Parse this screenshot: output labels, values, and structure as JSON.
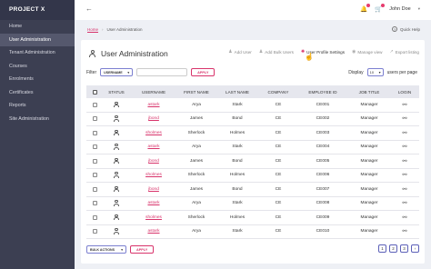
{
  "brand": "PROJECT X",
  "sidebar": {
    "items": [
      {
        "label": "Home",
        "active": false
      },
      {
        "label": "User Administration",
        "active": true
      },
      {
        "label": "Tenant Administration",
        "active": false
      },
      {
        "label": "Courses",
        "active": false
      },
      {
        "label": "Enrolments",
        "active": false
      },
      {
        "label": "Certificates",
        "active": false
      },
      {
        "label": "Reports",
        "active": false
      },
      {
        "label": "Site Administration",
        "active": false
      }
    ]
  },
  "topbar": {
    "user_name": "John Doe"
  },
  "breadcrumb": {
    "home": "Home",
    "current": "User Administration",
    "quick_help": "Quick Help"
  },
  "page": {
    "title": "User Administration",
    "actions": [
      {
        "label": "Add User",
        "icon": "add-user-icon",
        "active": false
      },
      {
        "label": "Add Bulk Users",
        "icon": "add-bulk-users-icon",
        "active": false
      },
      {
        "label": "User Profile Settings",
        "icon": "settings-icon",
        "active": true
      },
      {
        "label": "Manage view",
        "icon": "eye-icon",
        "active": false
      },
      {
        "label": "Export listing",
        "icon": "export-icon",
        "active": false
      }
    ]
  },
  "filter": {
    "label": "Filter",
    "select_value": "USERNAME",
    "input_value": "",
    "apply_label": "APPLY"
  },
  "display": {
    "label": "Display",
    "value": "10",
    "suffix": "users per page"
  },
  "table": {
    "columns": [
      "STATUS",
      "USERNAME",
      "FIRST NAME",
      "LAST NAME",
      "COMPANY",
      "EMPLOYEE ID",
      "JOB TITLE",
      "LOGIN"
    ],
    "rows": [
      {
        "username": "astark",
        "first": "Arya",
        "last": "Stark",
        "company": "CE",
        "emp_id": "CE001",
        "job": "Manager"
      },
      {
        "username": "jbond",
        "first": "James",
        "last": "Bond",
        "company": "CE",
        "emp_id": "CE002",
        "job": "Manager"
      },
      {
        "username": "sholmes",
        "first": "Sherlock",
        "last": "Holmes",
        "company": "CE",
        "emp_id": "CE003",
        "job": "Manager"
      },
      {
        "username": "astark",
        "first": "Arya",
        "last": "Stark",
        "company": "CE",
        "emp_id": "CE004",
        "job": "Manager"
      },
      {
        "username": "jbond",
        "first": "James",
        "last": "Bond",
        "company": "CE",
        "emp_id": "CE005",
        "job": "Manager"
      },
      {
        "username": "sholmes",
        "first": "Sherlock",
        "last": "Holmes",
        "company": "CE",
        "emp_id": "CE006",
        "job": "Manager"
      },
      {
        "username": "jbond",
        "first": "James",
        "last": "Bond",
        "company": "CE",
        "emp_id": "CE007",
        "job": "Manager"
      },
      {
        "username": "astark",
        "first": "Arya",
        "last": "Stark",
        "company": "CE",
        "emp_id": "CE008",
        "job": "Manager"
      },
      {
        "username": "sholmes",
        "first": "Sherlock",
        "last": "Holmes",
        "company": "CE",
        "emp_id": "CE009",
        "job": "Manager"
      },
      {
        "username": "astark",
        "first": "Arya",
        "last": "Stark",
        "company": "CE",
        "emp_id": "CE010",
        "job": "Manager"
      }
    ]
  },
  "bottom": {
    "bulk_label": "BULK ACTIONS",
    "apply_label": "APPLY",
    "pages": [
      "1",
      "2",
      "3"
    ]
  },
  "colors": {
    "accent": "#d8336b",
    "sidebar": "#3c3f52",
    "select_border": "#7b7fd0"
  }
}
